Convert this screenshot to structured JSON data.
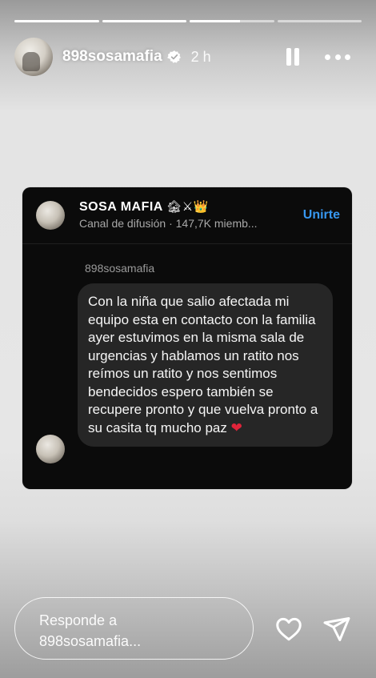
{
  "progress": [
    1,
    1,
    0.6,
    0
  ],
  "header": {
    "username": "898sosamafia",
    "time": "2 h"
  },
  "card": {
    "channel_name": "SOSA MAFIA",
    "channel_emojis": "🏚⚔👑",
    "channel_sub": "Canal de difusión · 147,7K miemb...",
    "join_label": "Unirte",
    "sender": "898sosamafia",
    "message": "Con la niña que salio afectada mi equipo esta en contacto con la familia ayer estuvimos en la misma sala de urgencias y hablamos un ratito nos reímos un ratito y nos sentimos bendecidos espero también se recupere pronto y que vuelva pronto a su casita tq mucho paz",
    "heart": "❤"
  },
  "reply": {
    "line1": "Responde a",
    "line2": "898sosamafia..."
  },
  "icons": {
    "verified": "verified-badge-icon",
    "pause": "pause-icon",
    "more": "more-options-icon",
    "like": "heart-icon",
    "send": "send-icon"
  }
}
